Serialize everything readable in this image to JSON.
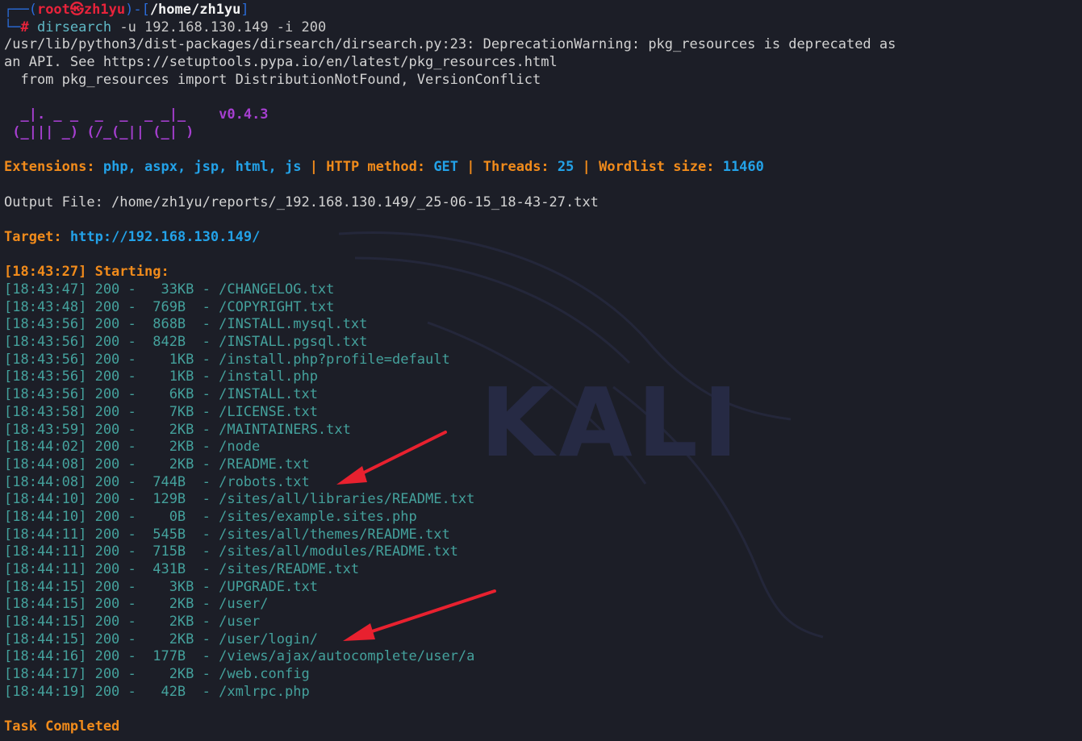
{
  "prompt": {
    "user": "root",
    "skull": "㉿",
    "host": "zh1yu",
    "path": "/home/zh1yu",
    "command": "dirsearch",
    "args": " -u 192.168.130.149 -i 200"
  },
  "warning": [
    "/usr/lib/python3/dist-packages/dirsearch/dirsearch.py:23: DeprecationWarning: pkg_resources is deprecated as",
    "an API. See https://setuptools.pypa.io/en/latest/pkg_resources.html",
    "  from pkg_resources import DistributionNotFound, VersionConflict"
  ],
  "banner": {
    "line1": "  _|. _ _  _  _  _ _|_",
    "line2": " (_||| _) (/_(_|| (_| )",
    "version": "v0.4.3"
  },
  "config": {
    "extensions_label": "Extensions:",
    "extensions_value": "php, aspx, jsp, html, js",
    "method_label": "HTTP method:",
    "method_value": "GET",
    "threads_label": "Threads:",
    "threads_value": "25",
    "wordlist_label": "Wordlist size:",
    "wordlist_value": "11460",
    "separator": "|"
  },
  "output_file": "Output File: /home/zh1yu/reports/_192.168.130.149/_25-06-15_18-43-27.txt",
  "target": {
    "label": "Target:",
    "url": "http://192.168.130.149/"
  },
  "starting": "[18:43:27] Starting:",
  "results": [
    "[18:43:47] 200 -   33KB - /CHANGELOG.txt",
    "[18:43:48] 200 -  769B  - /COPYRIGHT.txt",
    "[18:43:56] 200 -  868B  - /INSTALL.mysql.txt",
    "[18:43:56] 200 -  842B  - /INSTALL.pgsql.txt",
    "[18:43:56] 200 -    1KB - /install.php?profile=default",
    "[18:43:56] 200 -    1KB - /install.php",
    "[18:43:56] 200 -    6KB - /INSTALL.txt",
    "[18:43:58] 200 -    7KB - /LICENSE.txt",
    "[18:43:59] 200 -    2KB - /MAINTAINERS.txt",
    "[18:44:02] 200 -    2KB - /node",
    "[18:44:08] 200 -    2KB - /README.txt",
    "[18:44:08] 200 -  744B  - /robots.txt",
    "[18:44:10] 200 -  129B  - /sites/all/libraries/README.txt",
    "[18:44:10] 200 -    0B  - /sites/example.sites.php",
    "[18:44:11] 200 -  545B  - /sites/all/themes/README.txt",
    "[18:44:11] 200 -  715B  - /sites/all/modules/README.txt",
    "[18:44:11] 200 -  431B  - /sites/README.txt",
    "[18:44:15] 200 -    3KB - /UPGRADE.txt",
    "[18:44:15] 200 -    2KB - /user/",
    "[18:44:15] 200 -    2KB - /user",
    "[18:44:15] 200 -    2KB - /user/login/",
    "[18:44:16] 200 -  177B  - /views/ajax/autocomplete/user/a",
    "[18:44:17] 200 -    2KB - /web.config",
    "[18:44:19] 200 -   42B  - /xmlrpc.php"
  ],
  "completed": "Task Completed",
  "watermark_text": "KALI",
  "annotations": {
    "arrow_color": "#e8212f",
    "arrow1_target": "/robots.txt",
    "arrow2_target": "/user/login/"
  }
}
